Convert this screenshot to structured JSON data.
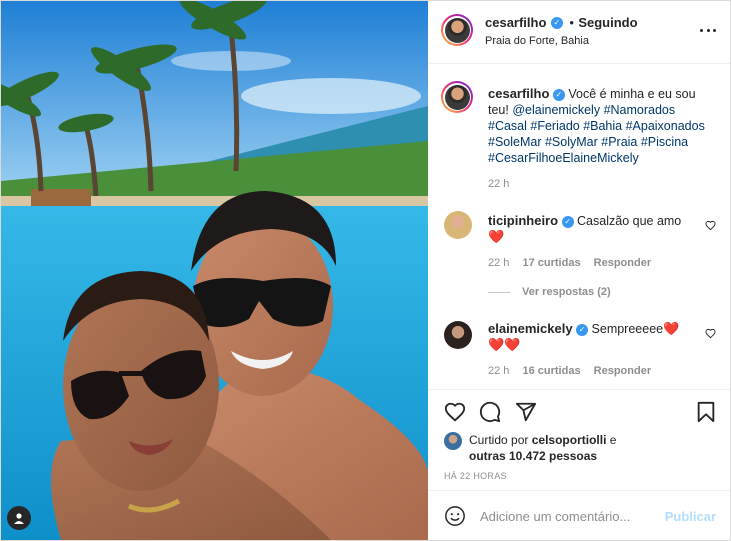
{
  "post": {
    "author": "cesarfilho",
    "follow_status": "Seguindo",
    "separator": "•",
    "location": "Praia do Forte, Bahia",
    "options_icon": "more-horizontal-icon"
  },
  "caption": {
    "author": "cesarfilho",
    "text_lead": "Você é minha e eu sou teu!",
    "mention": "@elainemickely",
    "hashtags_line1": "#Namorados",
    "hashtags_line2": "#Casal #Feriado #Bahia #Apaixonados",
    "hashtags_line3": "#SoleMar #SolyMar #Praia #Piscina",
    "hashtags_line4": "#CesarFilhoeElaineMickely",
    "time": "22 h"
  },
  "comments": [
    {
      "author": "ticipinheiro",
      "text": "Casalzão que amo",
      "emoji": "❤️",
      "time": "22 h",
      "likes": "17 curtidas",
      "reply": "Responder",
      "view_replies": "Ver respostas (2)"
    },
    {
      "author": "elainemickely",
      "text": "Sempreeeee",
      "emoji_inline": "❤️",
      "emoji_line2": "❤️❤️",
      "time": "22 h",
      "likes": "16 curtidas",
      "reply": "Responder"
    }
  ],
  "likes_summary": {
    "prefix": "Curtido por",
    "user": "celsoportiolli",
    "connector": "e",
    "others": "outras 10.472 pessoas"
  },
  "timestamp": "HÁ 22 HORAS",
  "comment_box": {
    "placeholder": "Adicione um comentário...",
    "publish": "Publicar"
  },
  "colors": {
    "verified": "#3897f0",
    "hashtag": "#00376b",
    "publish_disabled": "#b2dffc",
    "heart": "#ed1c40"
  }
}
